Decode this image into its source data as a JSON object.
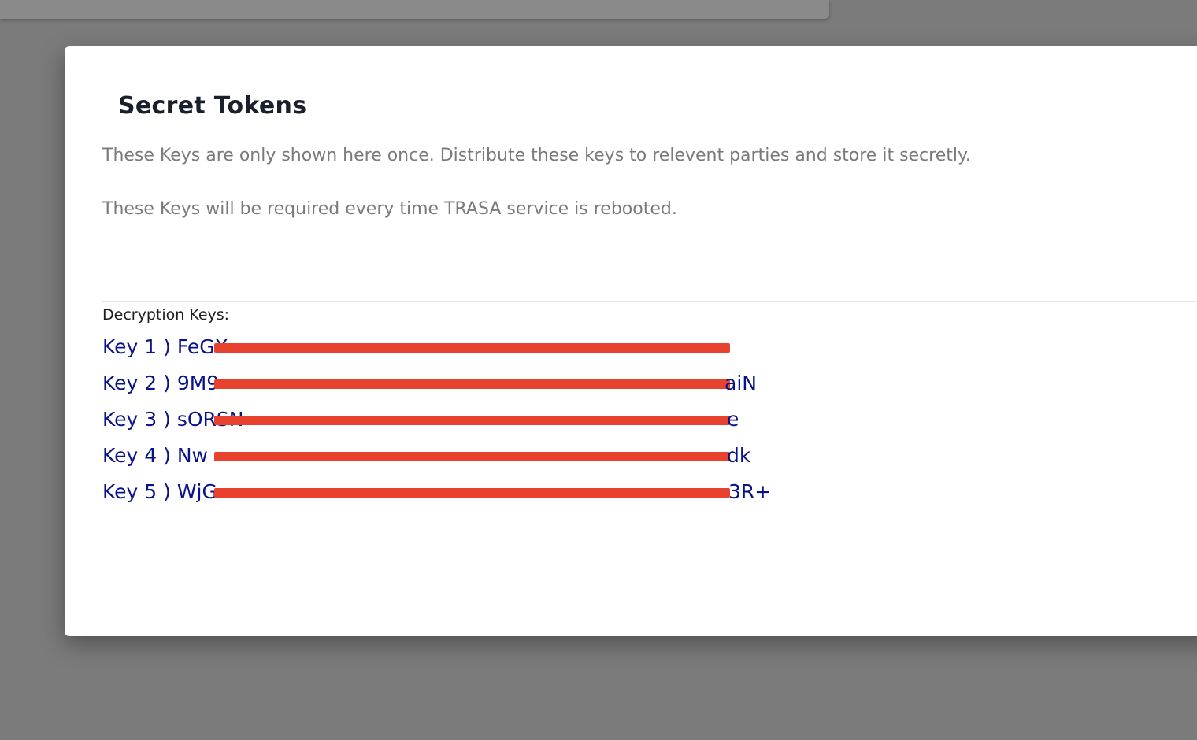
{
  "dialog": {
    "title": "Secret Tokens",
    "description_1": "These Keys are only shown here once. Distribute these keys to relevent parties and store it secretly.",
    "description_2": "These Keys will be required every time TRASA service is rebooted.",
    "keys_label": "Decryption Keys:",
    "keys": [
      "Key 1 ) FeGX",
      "Key 2 ) 9M9",
      "Key 3 ) sORSN",
      "Key 4 ) Nw",
      "Key 5 ) WjG"
    ],
    "keys_visible_tail": [
      "",
      "aiN",
      "e",
      "dk",
      "3R+"
    ]
  },
  "colors": {
    "overlay": "#7b7b7b",
    "dialog_bg": "#ffffff",
    "title": "#1a1f2b",
    "description": "#7a7a7a",
    "key_text": "#0a1287",
    "redaction": "#e8412d"
  }
}
